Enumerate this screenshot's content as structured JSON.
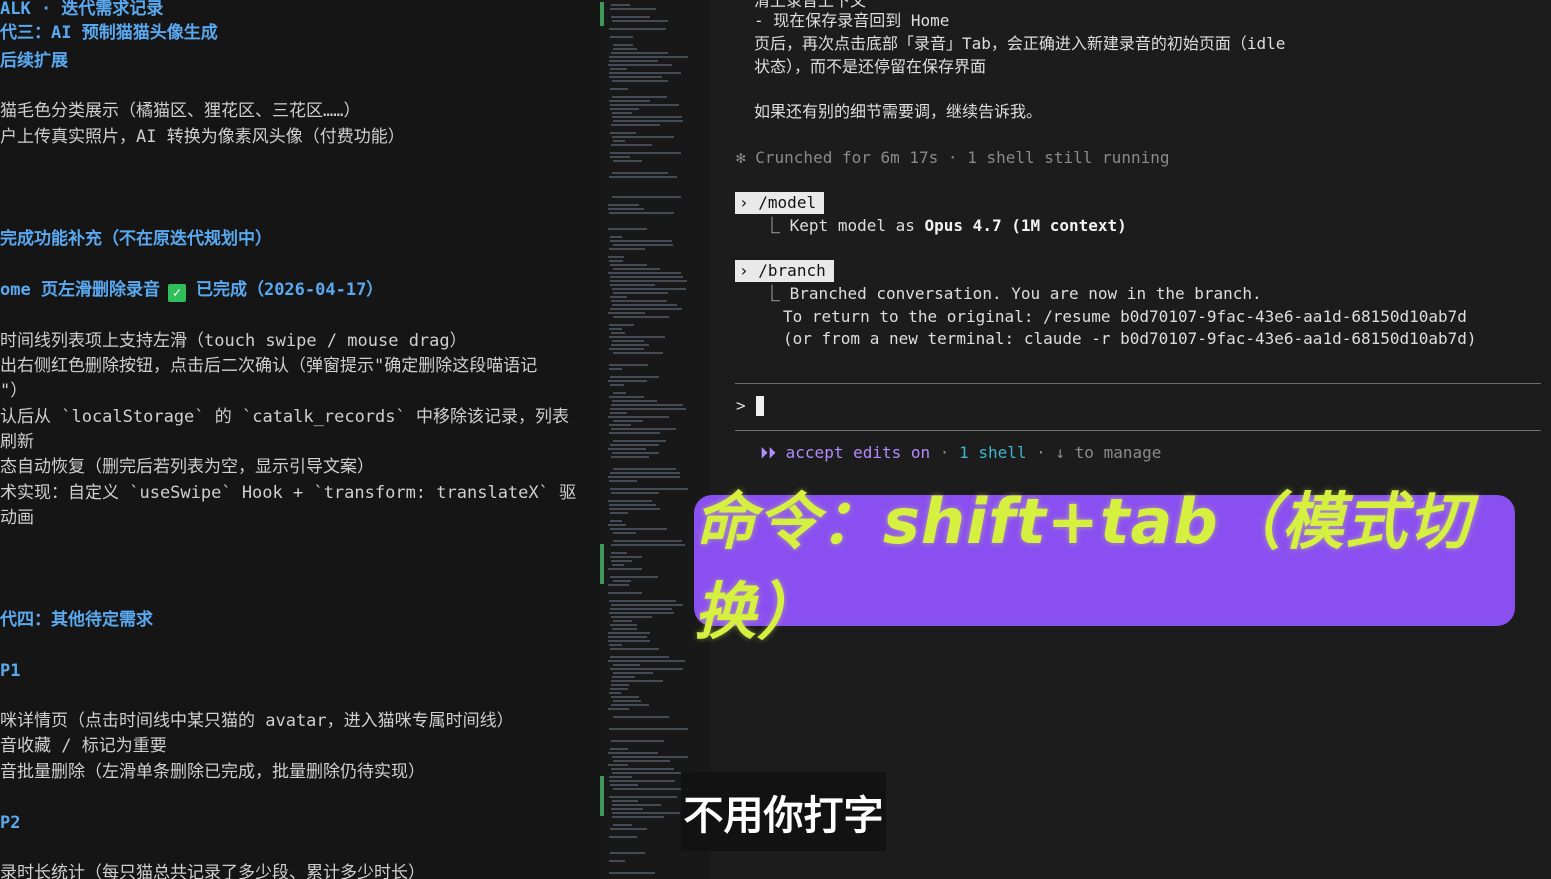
{
  "editor": {
    "lines": [
      {
        "text": "ALK · 迭代需求记录",
        "style": "h"
      },
      {
        "text": "代三：AI 预制猫猫头像生成",
        "style": "h"
      },
      {
        "text": "后续扩展",
        "style": "h"
      },
      {
        "text": "猫毛色分类展示（橘猫区、狸花区、三花区……）",
        "style": "p"
      },
      {
        "text": "户上传真实照片，AI 转换为像素风头像（付费功能）",
        "style": "p"
      },
      {
        "text": "完成功能补充（不在原迭代规划中）",
        "style": "h"
      },
      {
        "text": "ome 页左滑删除录音",
        "style": "h"
      },
      {
        "text": "已完成（2026-04-17）",
        "style": "h"
      },
      {
        "text": "时间线列表项上支持左滑（touch swipe / mouse drag）",
        "style": "p"
      },
      {
        "text": "出右侧红色删除按钮，点击后二次确认（弹窗提示\"确定删除这段喵语记",
        "style": "p"
      },
      {
        "text": "\"）",
        "style": "p"
      },
      {
        "text": "认后从 `localStorage` 的 `catalk_records` 中移除该记录，列表",
        "style": "p"
      },
      {
        "text": "刷新",
        "style": "p"
      },
      {
        "text": "态自动恢复（删完后若列表为空，显示引导文案）",
        "style": "p"
      },
      {
        "text": "术实现：自定义 `useSwipe` Hook + `transform: translateX` 驱",
        "style": "p"
      },
      {
        "text": "动画",
        "style": "p"
      },
      {
        "text": "代四：其他待定需求",
        "style": "h"
      },
      {
        "text": "P1",
        "style": "h"
      },
      {
        "text": "咪详情页（点击时间线中某只猫的 avatar，进入猫咪专属时间线）",
        "style": "p"
      },
      {
        "text": "音收藏 / 标记为重要",
        "style": "p"
      },
      {
        "text": "音批量删除（左滑单条删除已完成，批量删除仍待实现）",
        "style": "p"
      },
      {
        "text": "P2",
        "style": "h"
      },
      {
        "text": "录时长统计（每只猫总共记录了多少段、累计多少时长）",
        "style": "p"
      }
    ],
    "check_icon": "✓"
  },
  "terminal": {
    "top_lines": [
      "清上录音上下文",
      "  - 现在保存录音回到 Home",
      "页后，再次点击底部「录音」Tab，会正确进入新建录音的初始页面（idle",
      "状态），而不是还停留在保存界面",
      "如果还有别的细节需要调，继续告诉我。"
    ],
    "crunched": "✻ Crunched for 6m 17s · 1 shell still running",
    "model_cmd": "/model",
    "model_result_prefix": "Kept model as ",
    "model_result_bold": "Opus 4.7 (1M context)",
    "branch_cmd": "/branch",
    "branch_lines": [
      "Branched conversation. You are now in the branch.",
      "To return to the original: /resume b0d70107-9fac-43e6-aa1d-68150d10ab7d",
      "(or from a new terminal: claude -r b0d70107-9fac-43e6-aa1d-68150d10ab7d)"
    ],
    "prompt_char": ">",
    "status": {
      "accept": "accept edits on",
      "sep": " · ",
      "shell": "1 shell",
      "manage": "↓ to manage"
    }
  },
  "overlay": {
    "banner_text": "命令：shift+tab（模式切换）",
    "subtitle_text": "不用你打字"
  },
  "colors": {
    "banner_bg": "#8a4ff0",
    "banner_text": "#d6f040",
    "heading": "#5aa9f0",
    "accept_edits": "#b08cff",
    "shell": "#3fb6c9"
  }
}
